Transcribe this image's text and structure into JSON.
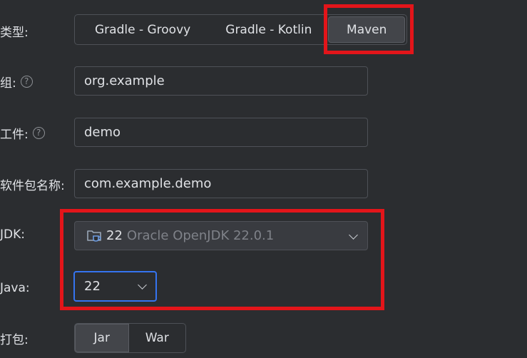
{
  "type_row": {
    "label": "类型:",
    "options": [
      "Gradle - Groovy",
      "Gradle - Kotlin",
      "Maven"
    ],
    "selected": "Maven"
  },
  "group_row": {
    "label": "组:",
    "help": "?",
    "value": "org.example"
  },
  "artifact_row": {
    "label": "工件:",
    "help": "?",
    "value": "demo"
  },
  "package_row": {
    "label": "软件包名称:",
    "value": "com.example.demo"
  },
  "jdk_row": {
    "label": "JDK:",
    "version": "22",
    "vendor": "Oracle OpenJDK 22.0.1"
  },
  "java_row": {
    "label": "Java:",
    "value": "22"
  },
  "packaging_row": {
    "label": "打包:",
    "options": [
      "Jar",
      "War"
    ],
    "selected": "Jar"
  },
  "colors": {
    "background": "#2b2d30",
    "highlight": "#e3151a",
    "focus": "#3574f0"
  },
  "icons": {
    "jdk": "folder-coffee-icon",
    "help": "question-circle-icon",
    "dropdown": "chevron-down-icon"
  }
}
